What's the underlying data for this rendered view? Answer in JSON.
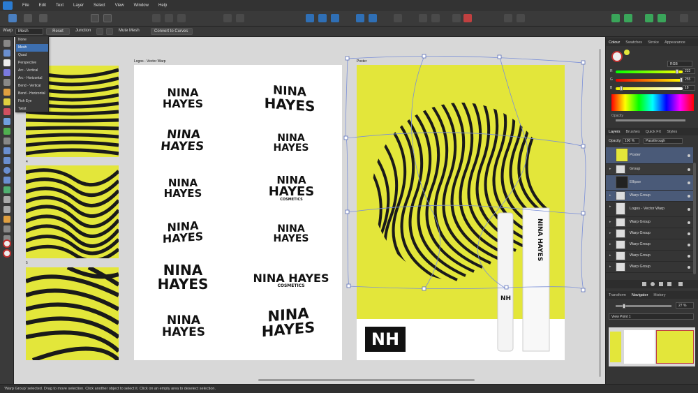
{
  "menu": {
    "items": [
      "File",
      "Edit",
      "Text",
      "Layer",
      "Select",
      "View",
      "Window",
      "Help"
    ]
  },
  "context": {
    "warp_label": "Warp",
    "warp_value": "Mesh",
    "reset": "Reset",
    "junction": "Junction",
    "mute_mesh": "Mute Mesh",
    "convert": "Convert to Curves"
  },
  "warp_menu": [
    "None",
    "Mesh",
    "Quad",
    "Perspective",
    "Arc - Vertical",
    "Arc - Horizontal",
    "Bend - Vertical",
    "Bend - Horizontal",
    "Fish Eye",
    "Twist"
  ],
  "canvas": {
    "thumb_labels": [
      "4",
      "5"
    ],
    "logos_title": "Logos - Vector Warp",
    "poster_title": "Poster",
    "logos": [
      {
        "l1": "NINA",
        "l2": "HAYES",
        "l3": ""
      },
      {
        "l1": "NINA",
        "l2": "HAYES",
        "l3": ""
      },
      {
        "l1": "NINA",
        "l2": "HAYES",
        "l3": ""
      },
      {
        "l1": "NINA",
        "l2": "HAYES",
        "l3": ""
      },
      {
        "l1": "NINA",
        "l2": "HAYES",
        "l3": ""
      },
      {
        "l1": "HAYES",
        "l2": "COSMETICS",
        "l3": "NINA"
      },
      {
        "l1": "NINA",
        "l2": "HAYES",
        "l3": ""
      },
      {
        "l1": "NINA",
        "l2": "HAYES",
        "l3": ""
      },
      {
        "l1": "NINA",
        "l2": "HAYES",
        "l3": ""
      },
      {
        "l1": "NINA HAYES",
        "l2": "COSMETICS",
        "l3": ""
      },
      {
        "l1": "NINA",
        "l2": "HAYES",
        "l3": ""
      },
      {
        "l1": "NINA",
        "l2": "HAYES",
        "l3": ""
      }
    ],
    "poster_logo": "NH",
    "tube_text": "NINA HAYES",
    "tube_cap": "NH"
  },
  "colour_panel": {
    "tabs": [
      "Colour",
      "Swatches",
      "Stroke",
      "Appearance"
    ],
    "mode": "RGB",
    "r_label": "R",
    "r_value": "232",
    "g_label": "G",
    "g_value": "255",
    "b_label": "B",
    "b_value": "18",
    "opacity_label": "Opacity"
  },
  "layers_panel": {
    "tabs": [
      "Layers",
      "Brushes",
      "Quick FX",
      "Styles"
    ],
    "opacity_label": "Opacity:",
    "opacity_value": "100 %",
    "blend": "Passthrough",
    "rows": [
      {
        "name": "Poster",
        "selected": true
      },
      {
        "name": "Group",
        "selected": false
      },
      {
        "name": "Ellipse",
        "selected": true
      },
      {
        "name": "Warp Group",
        "selected": true
      },
      {
        "name": "Logos - Vector Warp",
        "selected": false
      },
      {
        "name": "Warp Group",
        "selected": false
      },
      {
        "name": "Warp Group",
        "selected": false
      },
      {
        "name": "Warp Group",
        "selected": false
      },
      {
        "name": "Warp Group",
        "selected": false
      },
      {
        "name": "Warp Group",
        "selected": false
      }
    ]
  },
  "nav_panel": {
    "tabs": [
      "Transform",
      "Navigator",
      "History"
    ],
    "zoom": "27 %",
    "view_point": "View Point 1"
  },
  "status": {
    "text": "'Warp Group' selected. Drag to move selection. Click another object to select it. Click on an empty area to deselect selection."
  },
  "colors": {
    "yellow": "#e3e63a",
    "accent": "#3d6fb0"
  }
}
